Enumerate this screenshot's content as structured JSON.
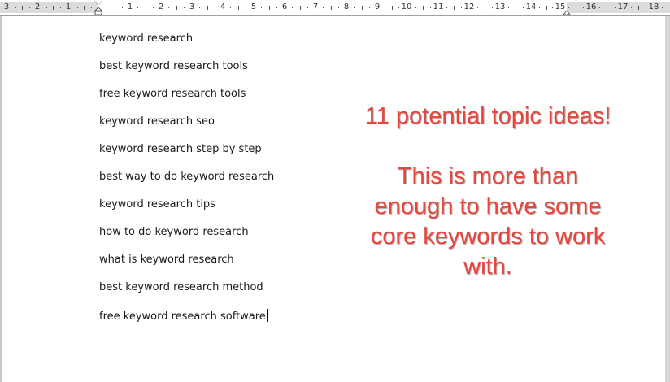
{
  "ruler": {
    "labels": [
      "3",
      "2",
      "1",
      "1",
      "2",
      "3",
      "4",
      "5",
      "6",
      "7",
      "8",
      "9",
      "10",
      "11",
      "12",
      "13",
      "14",
      "15",
      "16",
      "17",
      "18"
    ]
  },
  "keywords": [
    "keyword research",
    "best keyword research tools",
    "free keyword research tools",
    "keyword research seo",
    "keyword research step by step",
    "best way to do keyword research",
    "keyword research tips",
    "how to do keyword research",
    "what is keyword research",
    "best keyword research method",
    "free keyword research software"
  ],
  "annotation": {
    "headline": "11 potential topic ideas!",
    "lines": [
      "This is more than",
      "enough to have some",
      "core keywords to work",
      "with."
    ],
    "color": "#e8463c"
  }
}
